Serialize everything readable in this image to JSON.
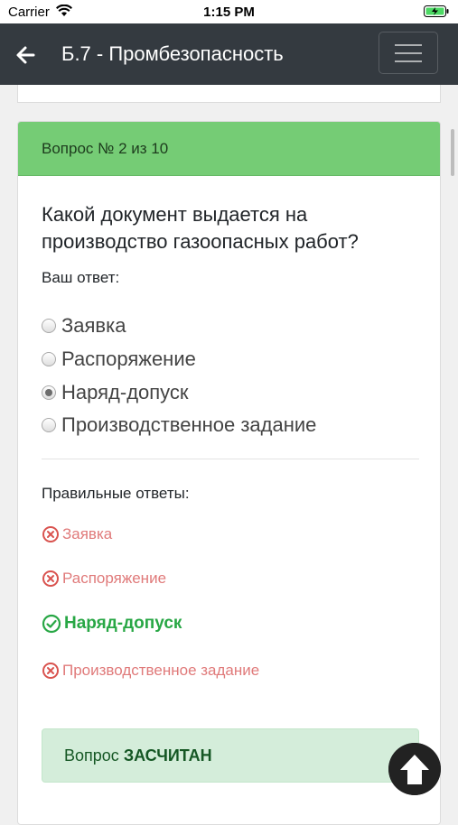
{
  "status_bar": {
    "carrier": "Carrier",
    "time": "1:15 PM",
    "icons": [
      "wifi-icon",
      "battery-charging-icon"
    ]
  },
  "navbar": {
    "title": "Б.7 - Промбезопасность",
    "icons": [
      "arrow-left-icon",
      "hamburger-menu-icon"
    ]
  },
  "card": {
    "header": "Вопрос № 2 из 10",
    "question": "Какой документ выдается на производство газоопасных работ?",
    "your_answer_label": "Ваш ответ:",
    "options": [
      {
        "label": "Заявка",
        "selected": false
      },
      {
        "label": "Распоряжение",
        "selected": false
      },
      {
        "label": "Наряд-допуск",
        "selected": true
      },
      {
        "label": "Производственное задание",
        "selected": false
      }
    ],
    "correct_title": "Правильные ответы:",
    "results": [
      {
        "label": "Заявка",
        "correct": false
      },
      {
        "label": "Распоряжение",
        "correct": false
      },
      {
        "label": "Наряд-допуск",
        "correct": true
      },
      {
        "label": "Производственное задание",
        "correct": false
      }
    ],
    "alert_prefix": "Вопрос",
    "alert_status": "ЗАСЧИТАН"
  },
  "colors": {
    "navbar_bg": "#343a40",
    "header_green": "#75cc75",
    "wrong_red": "#e07a7a",
    "correct_green": "#28a745",
    "alert_bg": "#d4edda"
  }
}
